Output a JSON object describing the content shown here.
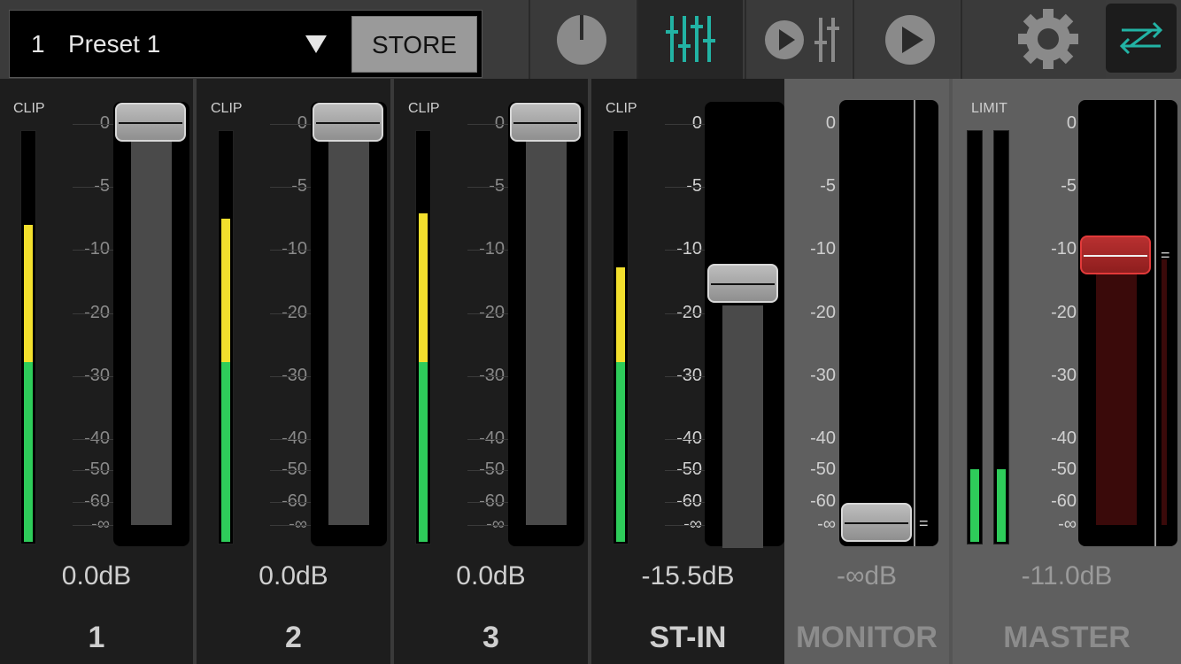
{
  "preset": {
    "number": "1",
    "name": "Preset 1",
    "store_label": "STORE"
  },
  "toolbar": {
    "items": [
      {
        "name": "gain-knob-icon",
        "active": false
      },
      {
        "name": "mixer-faders-icon",
        "active": true
      },
      {
        "name": "play-faders-icon",
        "active": false
      },
      {
        "name": "play-icon",
        "active": false
      },
      {
        "name": "gear-icon",
        "active": false
      },
      {
        "name": "swap-routing-icon",
        "active": true
      }
    ],
    "accent_color": "#22b3a4"
  },
  "scale_labels": [
    "0",
    "-5",
    "-10",
    "-20",
    "-30",
    "-40",
    "-50",
    "-60",
    "-∞"
  ],
  "channels": [
    {
      "name": "1",
      "clip_label": "CLIP",
      "db": "0.0dB",
      "level": 0.77
    },
    {
      "name": "2",
      "clip_label": "CLIP",
      "db": "0.0dB",
      "level": 0.79
    },
    {
      "name": "3",
      "clip_label": "CLIP",
      "db": "0.0dB",
      "level": 0.8
    },
    {
      "name": "ST-IN",
      "clip_label": "CLIP",
      "db": "-15.5dB",
      "level": 0.67
    },
    {
      "name": "MONITOR",
      "db": "-∞dB"
    },
    {
      "name": "MASTER",
      "limit_label": "LIMIT",
      "db": "-11.0dB"
    }
  ]
}
